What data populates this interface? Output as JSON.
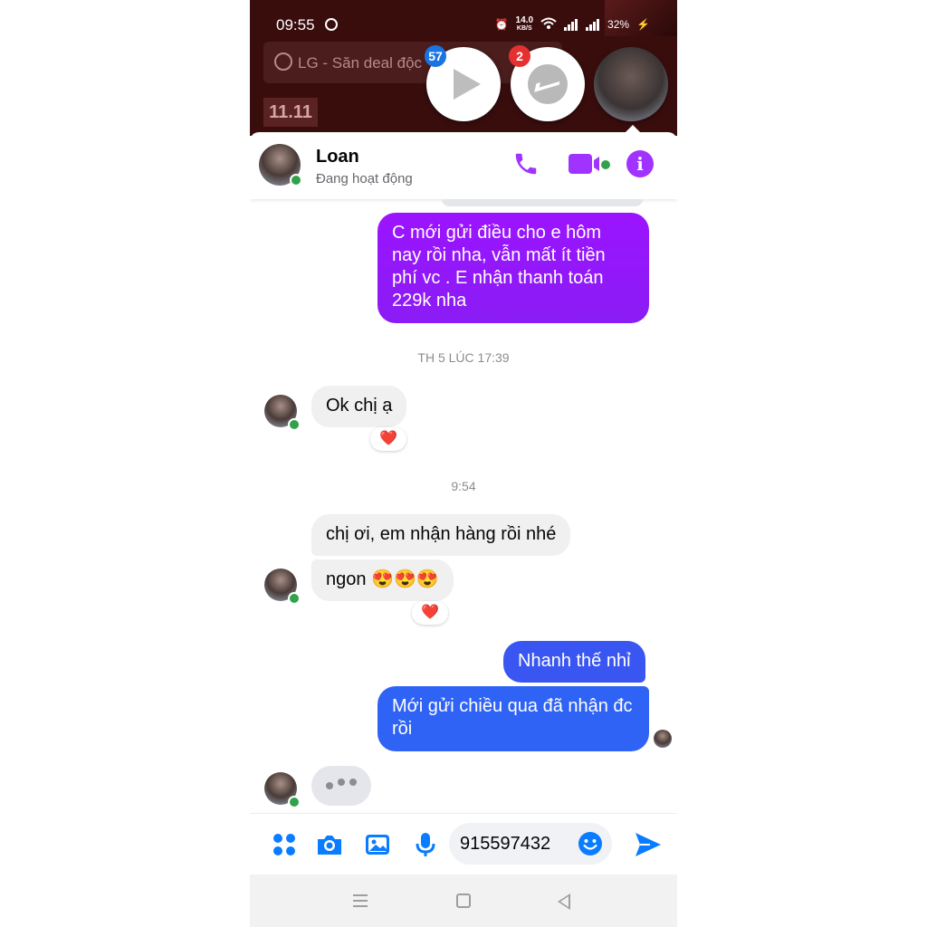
{
  "status_bar": {
    "time": "09:55",
    "net_speed": "14.0",
    "net_unit": "KB/S",
    "battery": "32%"
  },
  "background_app": {
    "search_text": "LG -  Săn deal độc",
    "promo": "11.11"
  },
  "chat_heads": {
    "video_badge": "57",
    "messenger_badge": "2"
  },
  "header": {
    "name": "Loan",
    "status": "Đang hoạt động"
  },
  "colors": {
    "accent_purple": "#a033ff",
    "outgoing_purple": "#9b14ff",
    "outgoing_blue": "#2f63f5",
    "online_green": "#31a24c",
    "messenger_blue": "#0a7cff"
  },
  "messages": {
    "out_1": "C mới gửi điều cho e hôm nay rồi nha, vẫn mất ít tiền phí vc . E nhận thanh toán 229k nha",
    "timestamp_1": "TH 5 LÚC 17:39",
    "in_1": "Ok chị ạ",
    "reaction_1": "❤️",
    "timestamp_2": "9:54",
    "in_2": "chị ơi, em nhận hàng rồi nhé",
    "in_3": "ngon 😍😍😍",
    "reaction_2": "❤️",
    "out_2": "Nhanh thế nhỉ",
    "out_3": "Mới gửi chiều qua đã nhận đc rồi"
  },
  "composer": {
    "input_value": "915597432",
    "icons": [
      "apps-icon",
      "camera-icon",
      "image-icon",
      "mic-icon",
      "emoji-icon",
      "send-icon"
    ]
  }
}
